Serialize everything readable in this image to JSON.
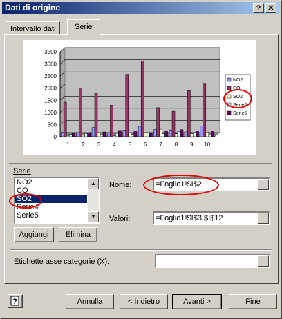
{
  "window": {
    "title": "Dati di origine",
    "help_label": "?",
    "close_label": "✕"
  },
  "tabs": [
    {
      "label": "Intervallo dati"
    },
    {
      "label": "Serie"
    }
  ],
  "chart_data": {
    "type": "bar",
    "categories": [
      "1",
      "2",
      "3",
      "4",
      "5",
      "6",
      "7",
      "8",
      "9",
      "10"
    ],
    "ylim": [
      0,
      3500
    ],
    "yticks": [
      0,
      500,
      1000,
      1500,
      2000,
      2500,
      3000,
      3500
    ],
    "series": [
      {
        "name": "NO2",
        "color": "#9999ff",
        "values": [
          180,
          170,
          380,
          170,
          270,
          430,
          300,
          280,
          200,
          440
        ]
      },
      {
        "name": "CO",
        "color": "#993366",
        "values": [
          1420,
          2010,
          1780,
          1300,
          2570,
          3120,
          1200,
          1050,
          1900,
          2200
        ]
      },
      {
        "name": "SO2",
        "color": "#ffffcc",
        "values": [
          50,
          60,
          150,
          40,
          150,
          160,
          310,
          120,
          120,
          190
        ]
      },
      {
        "name": "Serie4",
        "color": "#ccffff",
        "values": [
          100,
          130,
          70,
          140,
          90,
          170,
          120,
          210,
          180,
          70
        ]
      },
      {
        "name": "Serie5",
        "color": "#660066",
        "values": [
          140,
          160,
          200,
          260,
          240,
          170,
          250,
          290,
          250,
          240
        ]
      }
    ],
    "legend": "right",
    "grid": true
  },
  "series_group": {
    "label": "Serie",
    "items": [
      "NO2",
      "CO",
      "SO2",
      "Serie4",
      "Serie5"
    ],
    "selected_index": 2,
    "add_label": "Aggiungi",
    "remove_label": "Elimina"
  },
  "name_field": {
    "label": "Nome:",
    "value": "=Foglio1!$I$2"
  },
  "values_field": {
    "label": "Valori:",
    "value": "=Foglio1!$I$3:$I$12"
  },
  "category_field": {
    "label": "Etichette asse categorie (X):",
    "value": ""
  },
  "footer": {
    "cancel_label": "Annulla",
    "back_label": "< Indietro",
    "next_label": "Avanti >",
    "finish_label": "Fine"
  },
  "colors": {
    "highlight": "#e00000",
    "selection": "#0a246a",
    "titlebar": "#0a246a"
  }
}
